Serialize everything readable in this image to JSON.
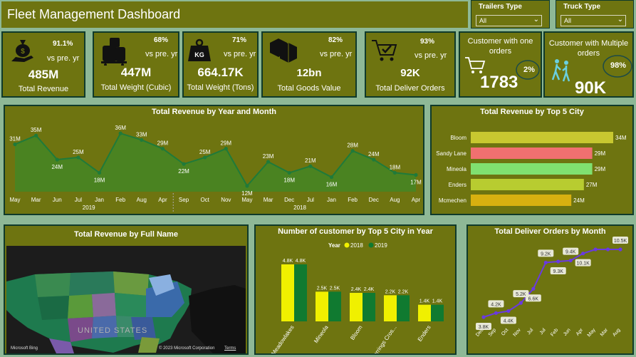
{
  "header": {
    "title": "Fleet Management Dashboard"
  },
  "filters": [
    {
      "label": "Trailers Type",
      "value": "All"
    },
    {
      "label": "Truck Type",
      "value": "All"
    }
  ],
  "kpis": [
    {
      "value": "485M",
      "label": "Total Revenue",
      "pct": "91.1%",
      "vs": "vs pre. yr",
      "icon": "money-bag-icon"
    },
    {
      "value": "447M",
      "label": "Total Weight (Cubic)",
      "pct": "68%",
      "vs": "vs pre. yr",
      "icon": "luggage-icon"
    },
    {
      "value": "664.17K",
      "label": "Total Weight (Tons)",
      "pct": "71%",
      "vs": "vs pre. yr",
      "icon": "kg-weight-icon",
      "icon_text": "KG"
    },
    {
      "value": "12bn",
      "label": "Total Goods Value",
      "pct": "82%",
      "vs": "vs pre. yr",
      "icon": "boxes-icon"
    },
    {
      "value": "92K",
      "label": "Total Deliver Orders",
      "pct": "93%",
      "vs": "vs pre. yr",
      "icon": "cart-check-icon"
    }
  ],
  "customer_one": {
    "title": "Customer with one orders",
    "value": "1783",
    "pct": "2%"
  },
  "customer_multi": {
    "title": "Customer with Multiple orders",
    "value": "90K",
    "pct": "98%"
  },
  "revenue_ym": {
    "title": "Total Revenue by Year and Month",
    "chart_data": {
      "type": "area",
      "years": [
        "2019",
        "2018"
      ],
      "x": [
        "May",
        "Mar",
        "Jun",
        "Jul",
        "Jan",
        "Feb",
        "Aug",
        "Apr",
        "Sep",
        "Oct",
        "Nov",
        "May",
        "Mar",
        "Dec",
        "Jul",
        "Jan",
        "Feb",
        "Dec",
        "Aug",
        "Apr"
      ],
      "values": [
        31,
        35,
        24,
        25,
        18,
        36,
        33,
        29,
        22,
        25,
        29,
        12,
        23,
        18,
        21,
        16,
        28,
        24,
        18,
        17
      ],
      "labels": [
        "31M",
        "35M",
        "24M",
        "25M",
        "18M",
        "36M",
        "33M",
        "29M",
        "22M",
        "25M",
        "29M",
        "12M",
        "23M",
        "18M",
        "21M",
        "16M",
        "28M",
        "24M",
        "18M",
        "17M"
      ]
    }
  },
  "top_city": {
    "title": "Total Revenue by Top 5 City",
    "chart_data": {
      "type": "bar",
      "categories": [
        "Bloom",
        "Sandy Lane",
        "Mineola",
        "Enders",
        "Mcmechen"
      ],
      "values": [
        34,
        29,
        29,
        27,
        24
      ],
      "labels": [
        "34M",
        "29M",
        "29M",
        "27M",
        "24M"
      ],
      "colors": [
        "#c8c830",
        "#f07070",
        "#80e070",
        "#b8cc30",
        "#d8b010"
      ]
    }
  },
  "map": {
    "title": "Total Revenue by Full Name",
    "country_label": "UNITED STATES",
    "attribution_left": "Microsoft Bing",
    "attribution_right": "© 2023 Microsoft Corporation",
    "terms": "Terms"
  },
  "customers_city": {
    "title": "Number of customer by Top 5 City in Year",
    "legend_title": "Year",
    "chart_data": {
      "type": "bar",
      "categories": [
        "Meadowlakes",
        "Mineola",
        "Bloom",
        "Herrings Cros...",
        "Enders"
      ],
      "series": [
        {
          "name": "2018",
          "color": "#f0f000",
          "values": [
            4.8,
            2.5,
            2.4,
            2.2,
            1.4
          ],
          "labels": [
            "4.8K",
            "2.5K",
            "2.4K",
            "2.2K",
            "1.4K"
          ]
        },
        {
          "name": "2019",
          "color": "#107a30",
          "values": [
            4.8,
            2.5,
            2.4,
            2.2,
            1.4
          ],
          "labels": [
            "4.8K",
            "2.5K",
            "2.4K",
            "2.2K",
            "1.4K"
          ]
        }
      ]
    }
  },
  "deliver_month": {
    "title": "Total Deliver Orders by Month",
    "chart_data": {
      "type": "line",
      "x": [
        "Dec",
        "Sep",
        "Oct",
        "Nov",
        "Jul",
        "Jul",
        "Feb",
        "Jun",
        "Apr",
        "May",
        "Mar",
        "Aug"
      ],
      "values": [
        3.8,
        4.2,
        4.4,
        5.2,
        6.6,
        9.2,
        9.3,
        9.4,
        10.1,
        10.5,
        10.5,
        10.5
      ],
      "labels": [
        "3.8K",
        "4.2K",
        "4.4K",
        "5.2K",
        "6.6K",
        "9.2K",
        "9.3K",
        "9.4K",
        "10.1K",
        "",
        "",
        "10.5K"
      ]
    }
  }
}
